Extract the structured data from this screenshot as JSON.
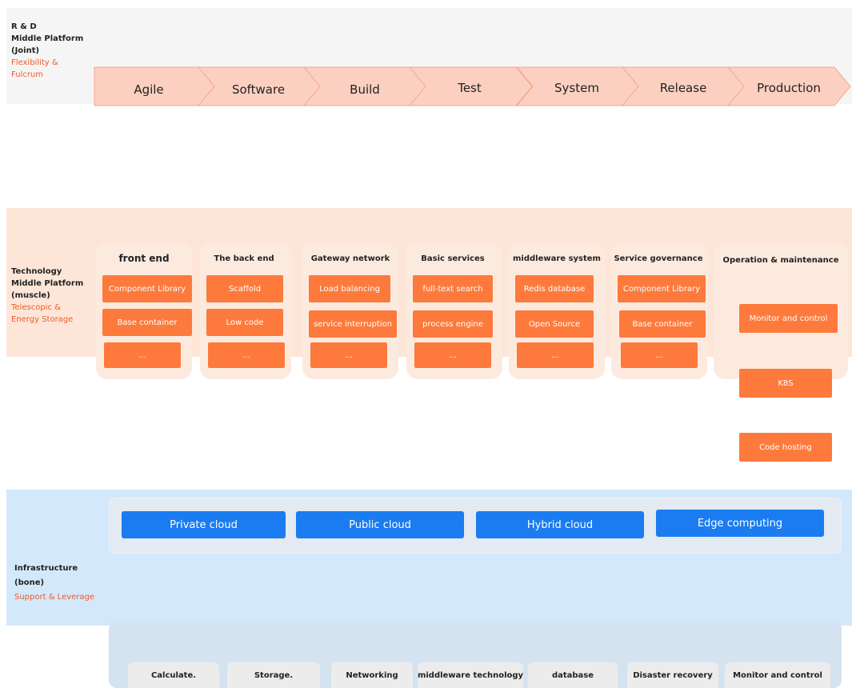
{
  "rd": {
    "label_lines": [
      "R & D",
      "Middle Platform",
      "(Joint)"
    ],
    "sub_lines": [
      "Flexibility &",
      "Fulcrum"
    ],
    "stages": [
      "Agile",
      "Software",
      "Build",
      "Test",
      "System",
      "Release",
      "Production"
    ]
  },
  "tech": {
    "label_lines": [
      "Technology",
      "Middle Platform",
      "(muscle)"
    ],
    "sub_lines": [
      "Telescopic &",
      "Energy Storage"
    ],
    "columns": [
      {
        "title": "front end",
        "items": [
          "Component Library",
          "Base container",
          "..."
        ]
      },
      {
        "title": "The back end",
        "items": [
          "Scaffold",
          "Low code",
          "..."
        ]
      },
      {
        "title": "Gateway network",
        "items": [
          "Load balancing",
          "service interruption",
          "..."
        ]
      },
      {
        "title": "Basic services",
        "items": [
          "full-text search",
          "process engine",
          "..."
        ]
      },
      {
        "title": "middleware system",
        "items": [
          "Redis database",
          "Open Source",
          "..."
        ]
      },
      {
        "title": "Service governance",
        "items": [
          "Component Library",
          "Base container",
          "..."
        ]
      }
    ],
    "ops": {
      "title": "Operation & maintenance",
      "items": [
        "Monitor and control",
        "K8S",
        "Code hosting"
      ]
    }
  },
  "infra": {
    "label_lines": [
      "Infrastructure",
      "(bone)"
    ],
    "sub_lines": [
      "Support & Leverage"
    ],
    "clouds": [
      "Private cloud",
      "Public cloud",
      "Hybrid cloud",
      "Edge computing"
    ],
    "base": [
      "Calculate.",
      "Storage.",
      "Networking",
      "middleware technology",
      "database",
      "Disaster recovery",
      "Monitor and control"
    ]
  },
  "colors": {
    "accent_orange": "#fe7a3c",
    "accent_red": "#f05a28",
    "accent_blue": "#1a7cf0",
    "stage_fill": "#fbd0c0"
  }
}
